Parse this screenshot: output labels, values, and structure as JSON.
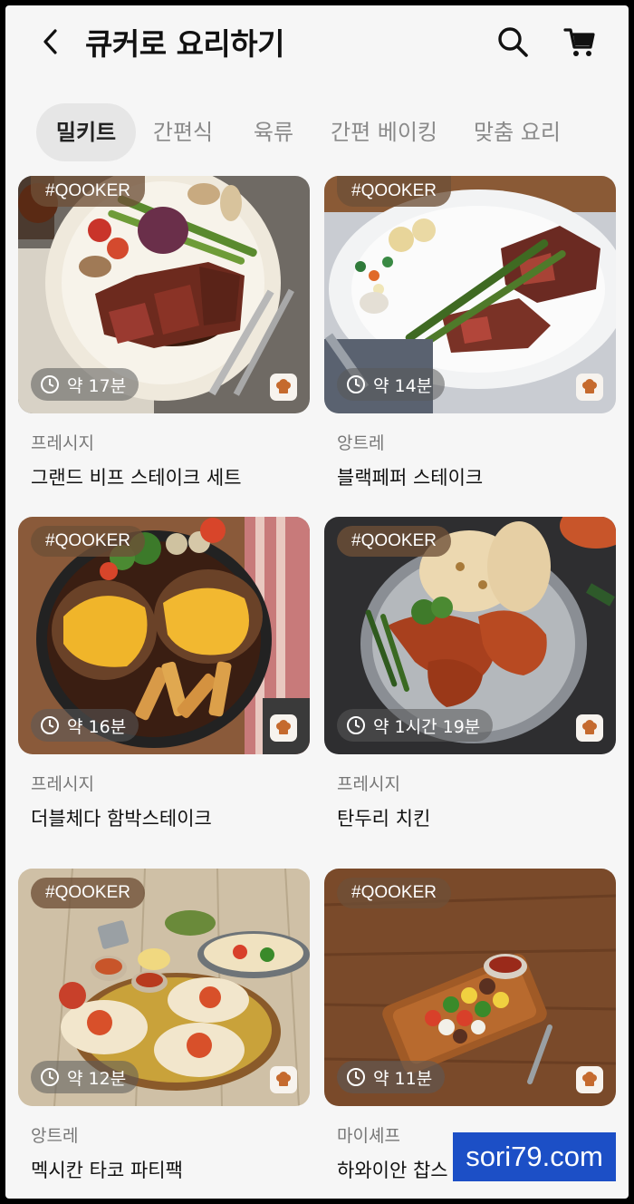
{
  "header": {
    "title": "큐커로 요리하기",
    "back_icon": "chevron-left-icon",
    "search_icon": "search-icon",
    "cart_icon": "cart-icon"
  },
  "tabs": [
    {
      "label": "밀키트",
      "active": true
    },
    {
      "label": "간편식",
      "active": false
    },
    {
      "label": "육류",
      "active": false
    },
    {
      "label": "간편 베이킹",
      "active": false
    },
    {
      "label": "맞춤 요리",
      "active": false
    }
  ],
  "products": [
    {
      "tag": "#QOOKER",
      "time": "약 17분",
      "brand": "프레시지",
      "name": "그랜드 비프 스테이크 세트"
    },
    {
      "tag": "#QOOKER",
      "time": "약 14분",
      "brand": "앙트레",
      "name": "블랙페퍼 스테이크"
    },
    {
      "tag": "#QOOKER",
      "time": "약 16분",
      "brand": "프레시지",
      "name": "더블체다 함박스테이크"
    },
    {
      "tag": "#QOOKER",
      "time": "약 1시간 19분",
      "brand": "프레시지",
      "name": "탄두리 치킨"
    },
    {
      "tag": "#QOOKER",
      "time": "약 12분",
      "brand": "앙트레",
      "name": "멕시칸 타코 파티팩"
    },
    {
      "tag": "#QOOKER",
      "time": "약 11분",
      "brand": "마이셰프",
      "name": "하와이안 찹스"
    }
  ],
  "watermark": "sori79.com",
  "colors": {
    "background": "#f6f6f6",
    "active_tab_bg": "#e6e6e6",
    "tag_bg": "#6e5037",
    "watermark_bg": "#1c4fc6"
  }
}
